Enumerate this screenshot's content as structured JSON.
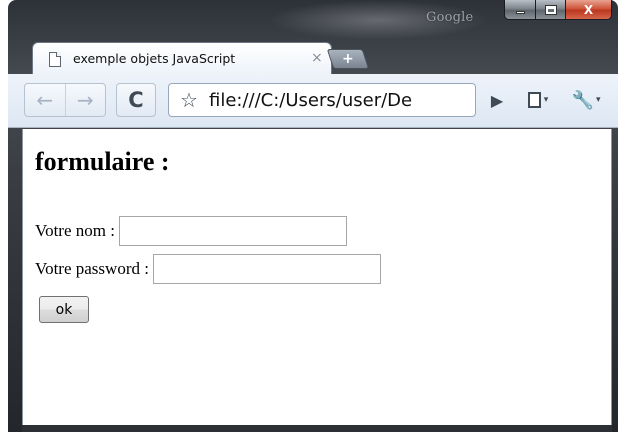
{
  "window": {
    "brand": "Google",
    "controls": {
      "minimize_icon": "minimize-icon",
      "maximize_icon": "maximize-icon",
      "close_label": "X"
    }
  },
  "tab": {
    "title": "exemple objets JavaScript",
    "close_label": "×",
    "icon": "page-icon"
  },
  "new_tab": {
    "label": "+"
  },
  "toolbar": {
    "back_label": "←",
    "forward_label": "→",
    "reload_label": "C",
    "star_label": "☆",
    "url": "file:///C:/Users/user/De",
    "go_label": "▶",
    "page_menu_caret": "▾",
    "wrench_label": "🔧",
    "wrench_caret": "▾"
  },
  "page": {
    "heading": "formulaire :",
    "form": {
      "name_label": "Votre nom :",
      "name_value": "",
      "password_label": "Votre password :",
      "password_value": "",
      "submit_label": "ok"
    }
  },
  "colors": {
    "frame_dark": "#2d3138",
    "toolbar_bg": "#eef3fa",
    "close_red": "#d0543b"
  }
}
